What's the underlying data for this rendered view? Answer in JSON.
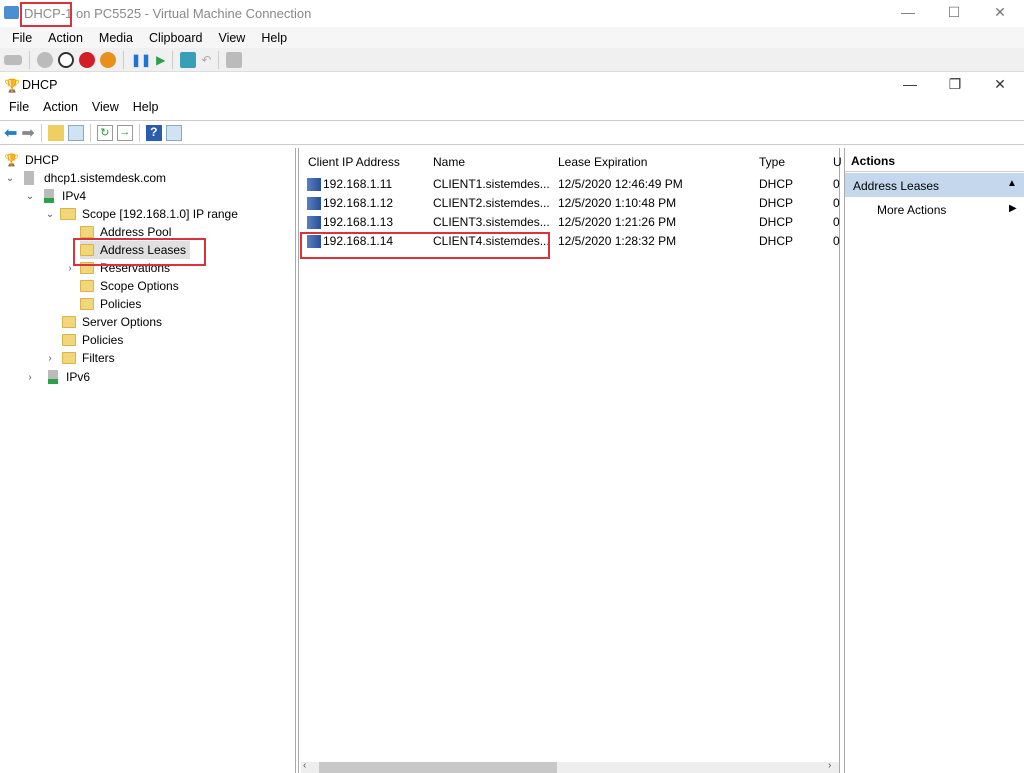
{
  "window": {
    "title": "DHCP-1 on PC5525 - Virtual Machine Connection",
    "minimize": "—",
    "maximize": "☐",
    "close": "✕"
  },
  "vm_menu": [
    "File",
    "Action",
    "Media",
    "Clipboard",
    "View",
    "Help"
  ],
  "vm_toolbar_icons": [
    "ctrl-alt-del-icon",
    "start-icon",
    "turn-off-icon",
    "shutdown-icon",
    "power-icon",
    "pause-icon",
    "resume-icon",
    "checkpoint-icon",
    "revert-icon",
    "enhanced-session-icon"
  ],
  "app": {
    "title": "DHCP",
    "minimize": "—",
    "restore": "❐",
    "close": "✕"
  },
  "app_menu": [
    "File",
    "Action",
    "View",
    "Help"
  ],
  "tree": [
    {
      "label": "DHCP",
      "level": 0
    },
    {
      "label": "dhcp1.sistemdesk.com",
      "level": 1,
      "expanded": true
    },
    {
      "label": "IPv4",
      "level": 2,
      "expanded": true
    },
    {
      "label": "Scope [192.168.1.0] IP range",
      "level": 3,
      "expanded": true
    },
    {
      "label": "Address Pool",
      "level": 4
    },
    {
      "label": "Address Leases",
      "level": 4,
      "selected": true
    },
    {
      "label": "Reservations",
      "level": 4,
      "collapsed": true
    },
    {
      "label": "Scope Options",
      "level": 4
    },
    {
      "label": "Policies",
      "level": 4
    },
    {
      "label": "Server Options",
      "level": 3
    },
    {
      "label": "Policies",
      "level": 3
    },
    {
      "label": "Filters",
      "level": 3,
      "collapsed": true
    },
    {
      "label": "IPv6",
      "level": 2,
      "collapsed": true
    }
  ],
  "table": {
    "columns": [
      "Client IP Address",
      "Name",
      "Lease Expiration",
      "Type",
      "U"
    ],
    "rows": [
      {
        "ip": "192.168.1.11",
        "name": "CLIENT1.sistemdes...",
        "lease": "12/5/2020 12:46:49 PM",
        "type": "DHCP",
        "u": "0"
      },
      {
        "ip": "192.168.1.12",
        "name": "CLIENT2.sistemdes...",
        "lease": "12/5/2020 1:10:48 PM",
        "type": "DHCP",
        "u": "0"
      },
      {
        "ip": "192.168.1.13",
        "name": "CLIENT3.sistemdes...",
        "lease": "12/5/2020 1:21:26 PM",
        "type": "DHCP",
        "u": "0"
      },
      {
        "ip": "192.168.1.14",
        "name": "CLIENT4.sistemdes...",
        "lease": "12/5/2020 1:28:32 PM",
        "type": "DHCP",
        "u": "0"
      }
    ]
  },
  "actions": {
    "header": "Actions",
    "section": "Address Leases",
    "more": "More Actions"
  },
  "colors": {
    "highlight": "#d9343d",
    "actions_section_bg": "#c5d7ec"
  }
}
